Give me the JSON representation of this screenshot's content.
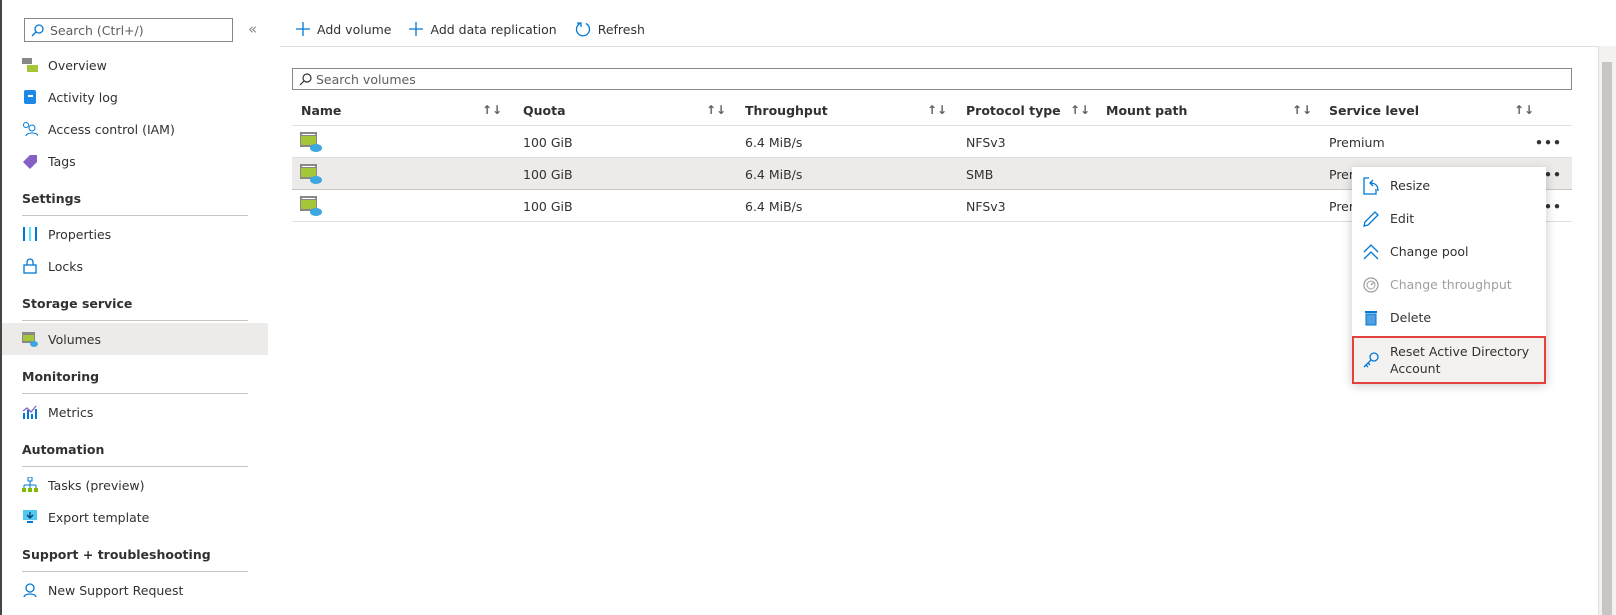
{
  "sidebar": {
    "search_placeholder": "Search (Ctrl+/)",
    "collapse": "«",
    "items_top": [
      {
        "label": "Overview",
        "icon": "overview-icon"
      },
      {
        "label": "Activity log",
        "icon": "activity-log-icon"
      },
      {
        "label": "Access control (IAM)",
        "icon": "iam-icon"
      },
      {
        "label": "Tags",
        "icon": "tag-icon"
      }
    ],
    "sections": [
      {
        "title": "Settings",
        "items": [
          {
            "label": "Properties"
          },
          {
            "label": "Locks"
          }
        ]
      },
      {
        "title": "Storage service",
        "items": [
          {
            "label": "Volumes",
            "selected": true
          }
        ]
      },
      {
        "title": "Monitoring",
        "items": [
          {
            "label": "Metrics"
          }
        ]
      },
      {
        "title": "Automation",
        "items": [
          {
            "label": "Tasks (preview)"
          },
          {
            "label": "Export template"
          }
        ]
      },
      {
        "title": "Support + troubleshooting",
        "items": [
          {
            "label": "New Support Request"
          }
        ]
      }
    ]
  },
  "toolbar": {
    "add_volume": "Add volume",
    "add_replication": "Add data replication",
    "refresh": "Refresh"
  },
  "search": {
    "placeholder": "Search volumes"
  },
  "table": {
    "columns": [
      "Name",
      "Quota",
      "Throughput",
      "Protocol type",
      "Mount path",
      "Service level"
    ],
    "rows": [
      {
        "name": "",
        "quota": "100 GiB",
        "throughput": "6.4 MiB/s",
        "protocol": "NFSv3",
        "mount": "",
        "level": "Premium"
      },
      {
        "name": "",
        "quota": "100 GiB",
        "throughput": "6.4 MiB/s",
        "protocol": "SMB",
        "mount": "",
        "level": "Premium",
        "selected": true
      },
      {
        "name": "",
        "quota": "100 GiB",
        "throughput": "6.4 MiB/s",
        "protocol": "NFSv3",
        "mount": "",
        "level": "Premium"
      }
    ],
    "more": "•••",
    "sort": "↑↓"
  },
  "context_menu": {
    "items": [
      {
        "label": "Resize",
        "icon": "resize-icon"
      },
      {
        "label": "Edit",
        "icon": "pencil-icon"
      },
      {
        "label": "Change pool",
        "icon": "chevron-up-double-icon"
      },
      {
        "label": "Change throughput",
        "icon": "gauge-icon",
        "disabled": true
      },
      {
        "label": "Delete",
        "icon": "trash-icon"
      },
      {
        "label": "Reset Active Directory Account",
        "icon": "key-icon",
        "highlighted": true
      }
    ]
  },
  "colors": {
    "accent": "#0078d4",
    "highlight_border": "#e5413b",
    "selected_bg": "#edebe9"
  }
}
